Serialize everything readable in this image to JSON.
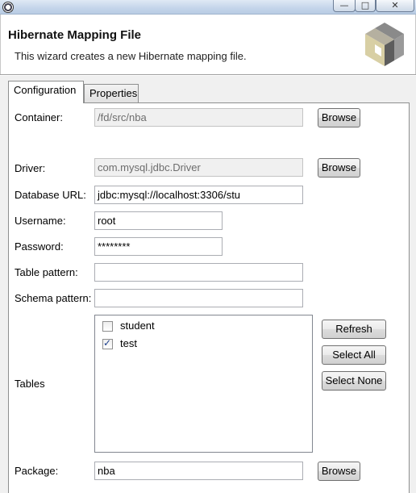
{
  "window": {
    "minimize_glyph": "—",
    "maximize_glyph": "□",
    "close_glyph": "✕"
  },
  "header": {
    "title": "Hibernate Mapping File",
    "description": "This wizard creates a new Hibernate mapping file."
  },
  "tabs": [
    {
      "label": "Configuration",
      "selected": true
    },
    {
      "label": "Properties",
      "selected": false
    }
  ],
  "form": {
    "container": {
      "label": "Container:",
      "value": "/fd/src/nba",
      "enabled": false,
      "button": "Browse"
    },
    "driver": {
      "label": "Driver:",
      "value": "com.mysql.jdbc.Driver",
      "enabled": false,
      "button": "Browse"
    },
    "database_url": {
      "label": "Database URL:",
      "value": "jdbc:mysql://localhost:3306/stu"
    },
    "username": {
      "label": "Username:",
      "value": "root"
    },
    "password": {
      "label": "Password:",
      "value": "********"
    },
    "table_pattern": {
      "label": "Table pattern:",
      "value": ""
    },
    "schema_pattern": {
      "label": "Schema pattern:",
      "value": ""
    },
    "tables": {
      "label": "Tables",
      "items": [
        {
          "name": "student",
          "checked": false
        },
        {
          "name": "test",
          "checked": true
        }
      ],
      "buttons": {
        "refresh": "Refresh",
        "select_all": "Select All",
        "select_none": "Select None"
      }
    },
    "package": {
      "label": "Package:",
      "value": "nba",
      "button": "Browse"
    }
  },
  "colors": {
    "panel_bg": "#ffffff",
    "dialog_bg": "#f0f0f0",
    "disabled_field_bg": "#f0f0f0",
    "check_color": "#1c3f8c"
  },
  "icons": {
    "app": "eclipse-app-icon",
    "logo": "hibernate-logo-icon",
    "checkbox_checked": "checkmark-icon"
  }
}
